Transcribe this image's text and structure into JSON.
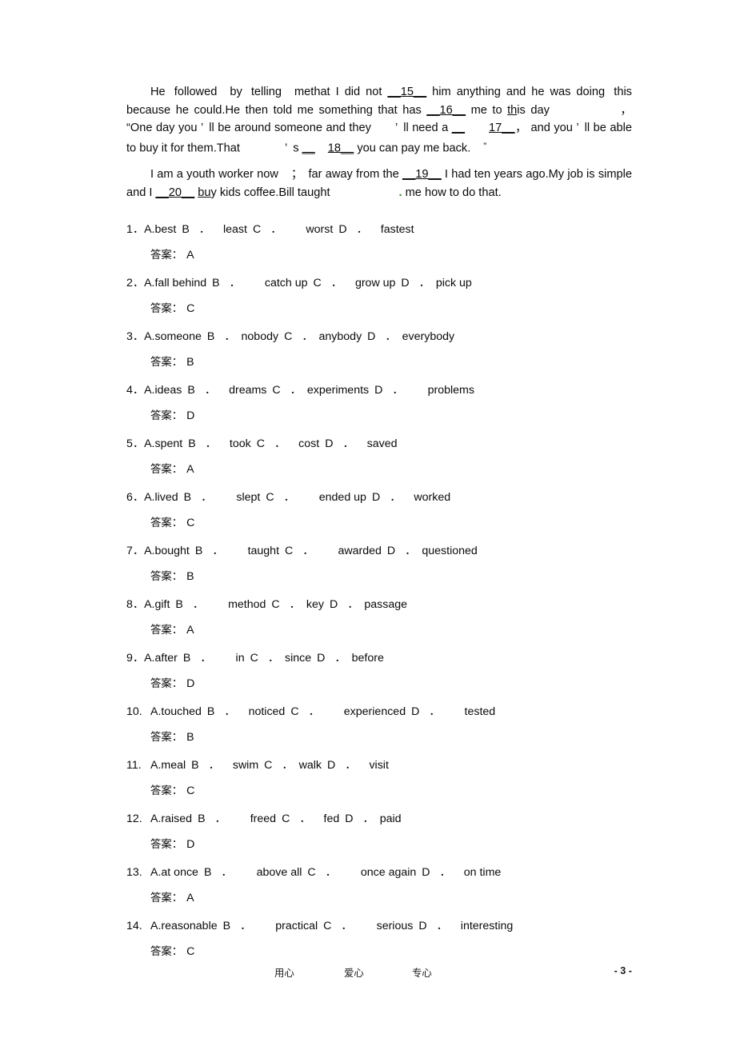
{
  "document": {
    "passages": [
      {
        "id": "passage-1",
        "segments": [
          {
            "t": "indent"
          },
          {
            "t": "text",
            "v": "He followed"
          },
          {
            "t": "sp-m"
          },
          {
            "t": "text",
            "v": "by telling"
          },
          {
            "t": "sp-m"
          },
          {
            "t": "text",
            "v": "methat"
          },
          {
            "t": "sp-s"
          },
          {
            "t": "text",
            "v": "I"
          },
          {
            "t": "sp-s"
          },
          {
            "t": "text",
            "v": "did"
          },
          {
            "t": "sp-s"
          },
          {
            "t": "text",
            "v": "not"
          },
          {
            "t": "sp-s"
          },
          {
            "t": "blank",
            "v": "__15__"
          },
          {
            "t": "sp-s"
          },
          {
            "t": "text",
            "v": "him"
          },
          {
            "t": "sp-s"
          },
          {
            "t": "text",
            "v": "anything"
          },
          {
            "t": "sp-s"
          },
          {
            "t": "text",
            "v": "and"
          },
          {
            "t": "sp-s"
          },
          {
            "t": "text",
            "v": "he"
          },
          {
            "t": "sp-s"
          },
          {
            "t": "text",
            "v": "was"
          },
          {
            "t": "sp-s"
          },
          {
            "t": "text",
            "v": "doing"
          },
          {
            "t": "text",
            "v": " this because he could.He then told me something that has "
          },
          {
            "t": "blank",
            "v": "__16__"
          },
          {
            "t": "text",
            "v": " me to "
          },
          {
            "t": "underline",
            "v": "th"
          },
          {
            "t": "text",
            "v": "is day"
          },
          {
            "t": "sp-xxl"
          },
          {
            "t": "text",
            "v": "，"
          },
          {
            "t": "text",
            "v": " “One day you "
          },
          {
            "t": "text",
            "v": "’"
          },
          {
            "t": "sp-s"
          },
          {
            "t": "text",
            "v": "ll be around someone and they"
          },
          {
            "t": "sp-l"
          },
          {
            "t": "text",
            "v": "’"
          },
          {
            "t": "sp-s"
          },
          {
            "t": "text",
            "v": "ll need a "
          },
          {
            "t": "blank",
            "v": "__"
          },
          {
            "t": "sp-l"
          },
          {
            "t": "blank",
            "v": "17__"
          },
          {
            "t": "text",
            "v": "，"
          },
          {
            "t": "text",
            "v": " and you "
          },
          {
            "t": "text",
            "v": "’"
          },
          {
            "t": "sp-s"
          },
          {
            "t": "text",
            "v": "ll be able to buy it for them.That"
          },
          {
            "t": "sp-xl"
          },
          {
            "t": "text",
            "v": "’"
          },
          {
            "t": "sp-s"
          },
          {
            "t": "text",
            "v": "s "
          },
          {
            "t": "blank",
            "v": "__"
          },
          {
            "t": "sp-m"
          },
          {
            "t": "blank",
            "v": "18__"
          },
          {
            "t": "text",
            "v": " you can pay me back."
          },
          {
            "t": "sp-m"
          },
          {
            "t": "hiquote",
            "v": "”"
          }
        ]
      },
      {
        "id": "passage-2",
        "segments": [
          {
            "t": "indent"
          },
          {
            "t": "text",
            "v": "I am a youth worker now"
          },
          {
            "t": "sp-m"
          },
          {
            "t": "text",
            "v": "；"
          },
          {
            "t": "sp-s"
          },
          {
            "t": "text",
            "v": "far away from the "
          },
          {
            "t": "blank",
            "v": "__19__"
          },
          {
            "t": "text",
            "v": " I had ten years ago.My job is simple and I "
          },
          {
            "t": "blank",
            "v": "__20__"
          },
          {
            "t": "text",
            "v": " "
          },
          {
            "t": "underline",
            "v": "bu"
          },
          {
            "t": "text",
            "v": "y kids coffee.Bill taught"
          },
          {
            "t": "sp-xxl"
          },
          {
            "t": "greendot",
            "v": "."
          },
          {
            "t": "text",
            "v": " me how to do that."
          }
        ]
      }
    ],
    "answer_label": "答案：",
    "questions": [
      {
        "number": "1．",
        "wide": false,
        "options": [
          {
            "letter": "A.",
            "gap_before": "",
            "text": "best"
          },
          {
            "letter": "B",
            "gap_before": "s",
            "sep": "．",
            "gap_mid": "m",
            "text": "least"
          },
          {
            "letter": "C",
            "gap_before": "s",
            "sep": "．",
            "gap_mid": "l",
            "text": "worst"
          },
          {
            "letter": "D",
            "gap_before": "s",
            "sep": "．",
            "gap_mid": "m",
            "text": "fastest"
          }
        ],
        "answer": "A"
      },
      {
        "number": "2．",
        "wide": false,
        "options": [
          {
            "letter": "A.",
            "gap_before": "",
            "text": "fall behind"
          },
          {
            "letter": "B",
            "gap_before": "s",
            "sep": "．",
            "gap_mid": "l",
            "text": "catch up"
          },
          {
            "letter": "C",
            "gap_before": "s",
            "sep": "．",
            "gap_mid": "m",
            "text": "grow up"
          },
          {
            "letter": "D",
            "gap_before": "s",
            "sep": "．",
            "gap_mid": "s",
            "text": "pick up"
          }
        ],
        "answer": "C"
      },
      {
        "number": "3．",
        "wide": false,
        "options": [
          {
            "letter": "A.",
            "gap_before": "",
            "text": "someone"
          },
          {
            "letter": "B",
            "gap_before": "s",
            "sep": "．",
            "gap_mid": "s",
            "text": "nobody"
          },
          {
            "letter": "C",
            "gap_before": "s",
            "sep": "．",
            "gap_mid": "s",
            "text": "anybody"
          },
          {
            "letter": "D",
            "gap_before": "s",
            "sep": "．",
            "gap_mid": "s",
            "text": "everybody"
          }
        ],
        "answer": "B"
      },
      {
        "number": "4．",
        "wide": false,
        "options": [
          {
            "letter": "A.",
            "gap_before": "",
            "text": "ideas"
          },
          {
            "letter": "B",
            "gap_before": "s",
            "sep": "．",
            "gap_mid": "m",
            "text": "dreams"
          },
          {
            "letter": "C",
            "gap_before": "s",
            "sep": "．",
            "gap_mid": "s",
            "text": "experiments"
          },
          {
            "letter": "D",
            "gap_before": "s",
            "sep": "．",
            "gap_mid": "l",
            "text": "problems"
          }
        ],
        "answer": "D"
      },
      {
        "number": "5．",
        "wide": false,
        "options": [
          {
            "letter": "A.",
            "gap_before": "",
            "text": "spent"
          },
          {
            "letter": "B",
            "gap_before": "s",
            "sep": "．",
            "gap_mid": "m",
            "text": "took"
          },
          {
            "letter": "C",
            "gap_before": "s",
            "sep": "．",
            "gap_mid": "m",
            "text": "cost"
          },
          {
            "letter": "D",
            "gap_before": "s",
            "sep": "．",
            "gap_mid": "m",
            "text": "saved"
          }
        ],
        "answer": "A"
      },
      {
        "number": "6．",
        "wide": false,
        "options": [
          {
            "letter": "A.",
            "gap_before": "",
            "text": "lived"
          },
          {
            "letter": "B",
            "gap_before": "s",
            "sep": "．",
            "gap_mid": "l",
            "text": "slept"
          },
          {
            "letter": "C",
            "gap_before": "s",
            "sep": "．",
            "gap_mid": "l",
            "text": "ended up"
          },
          {
            "letter": "D",
            "gap_before": "s",
            "sep": "．",
            "gap_mid": "m",
            "text": "worked"
          }
        ],
        "answer": "C"
      },
      {
        "number": "7．",
        "wide": false,
        "options": [
          {
            "letter": "A.",
            "gap_before": "",
            "text": "bought"
          },
          {
            "letter": "B",
            "gap_before": "s",
            "sep": "．",
            "gap_mid": "l",
            "text": "taught"
          },
          {
            "letter": "C",
            "gap_before": "s",
            "sep": "．",
            "gap_mid": "l",
            "text": "awarded"
          },
          {
            "letter": "D",
            "gap_before": "s",
            "sep": "．",
            "gap_mid": "s",
            "text": "questioned"
          }
        ],
        "answer": "B"
      },
      {
        "number": "8．",
        "wide": false,
        "options": [
          {
            "letter": "A.",
            "gap_before": "",
            "text": "gift"
          },
          {
            "letter": "B",
            "gap_before": "s",
            "sep": "．",
            "gap_mid": "l",
            "text": "method"
          },
          {
            "letter": "C",
            "gap_before": "s",
            "sep": "．",
            "gap_mid": "s",
            "text": "key"
          },
          {
            "letter": "D",
            "gap_before": "s",
            "sep": "．",
            "gap_mid": "s",
            "text": "passage"
          }
        ],
        "answer": "A"
      },
      {
        "number": "9．",
        "wide": false,
        "options": [
          {
            "letter": "A.",
            "gap_before": "",
            "text": "after"
          },
          {
            "letter": "B",
            "gap_before": "s",
            "sep": "．",
            "gap_mid": "l",
            "text": "in"
          },
          {
            "letter": "C",
            "gap_before": "s",
            "sep": "．",
            "gap_mid": "s",
            "text": "since"
          },
          {
            "letter": "D",
            "gap_before": "s",
            "sep": "．",
            "gap_mid": "s",
            "text": "before"
          }
        ],
        "answer": "D"
      },
      {
        "number": "10.",
        "wide": true,
        "options": [
          {
            "letter": "A.",
            "gap_before": "",
            "text": "touched"
          },
          {
            "letter": "B",
            "gap_before": "s",
            "sep": "．",
            "gap_mid": "m",
            "text": "noticed"
          },
          {
            "letter": "C",
            "gap_before": "s",
            "sep": "．",
            "gap_mid": "l",
            "text": "experienced"
          },
          {
            "letter": "D",
            "gap_before": "s",
            "sep": "．",
            "gap_mid": "l",
            "text": "tested"
          }
        ],
        "answer": "B"
      },
      {
        "number": "11.",
        "wide": true,
        "options": [
          {
            "letter": "A.",
            "gap_before": "",
            "text": "meal"
          },
          {
            "letter": "B",
            "gap_before": "s",
            "sep": "．",
            "gap_mid": "m",
            "text": "swim"
          },
          {
            "letter": "C",
            "gap_before": "s",
            "sep": "．",
            "gap_mid": "s",
            "text": "walk"
          },
          {
            "letter": "D",
            "gap_before": "s",
            "sep": "．",
            "gap_mid": "m",
            "text": "visit"
          }
        ],
        "answer": "C"
      },
      {
        "number": "12.",
        "wide": true,
        "options": [
          {
            "letter": "A.",
            "gap_before": "",
            "text": "raised"
          },
          {
            "letter": "B",
            "gap_before": "s",
            "sep": "．",
            "gap_mid": "l",
            "text": "freed"
          },
          {
            "letter": "C",
            "gap_before": "s",
            "sep": "．",
            "gap_mid": "m",
            "text": "fed"
          },
          {
            "letter": "D",
            "gap_before": "s",
            "sep": "．",
            "gap_mid": "s",
            "text": "paid"
          }
        ],
        "answer": "D"
      },
      {
        "number": "13.",
        "wide": true,
        "options": [
          {
            "letter": "A.",
            "gap_before": "",
            "text": "at once"
          },
          {
            "letter": "B",
            "gap_before": "s",
            "sep": "．",
            "gap_mid": "l",
            "text": "above all"
          },
          {
            "letter": "C",
            "gap_before": "s",
            "sep": "．",
            "gap_mid": "l",
            "text": "once again"
          },
          {
            "letter": "D",
            "gap_before": "s",
            "sep": "．",
            "gap_mid": "m",
            "text": "on time"
          }
        ],
        "answer": "A"
      },
      {
        "number": "14.",
        "wide": true,
        "options": [
          {
            "letter": "A.",
            "gap_before": "",
            "text": "reasonable"
          },
          {
            "letter": "B",
            "gap_before": "s",
            "sep": "．",
            "gap_mid": "l",
            "text": "practical"
          },
          {
            "letter": "C",
            "gap_before": "s",
            "sep": "．",
            "gap_mid": "l",
            "text": "serious"
          },
          {
            "letter": "D",
            "gap_before": "s",
            "sep": "．",
            "gap_mid": "m",
            "text": "interesting"
          }
        ],
        "answer": "C"
      }
    ],
    "footer": {
      "word1": "用心",
      "word2": "爱心",
      "word3": "专心",
      "page": "- 3 -"
    }
  }
}
